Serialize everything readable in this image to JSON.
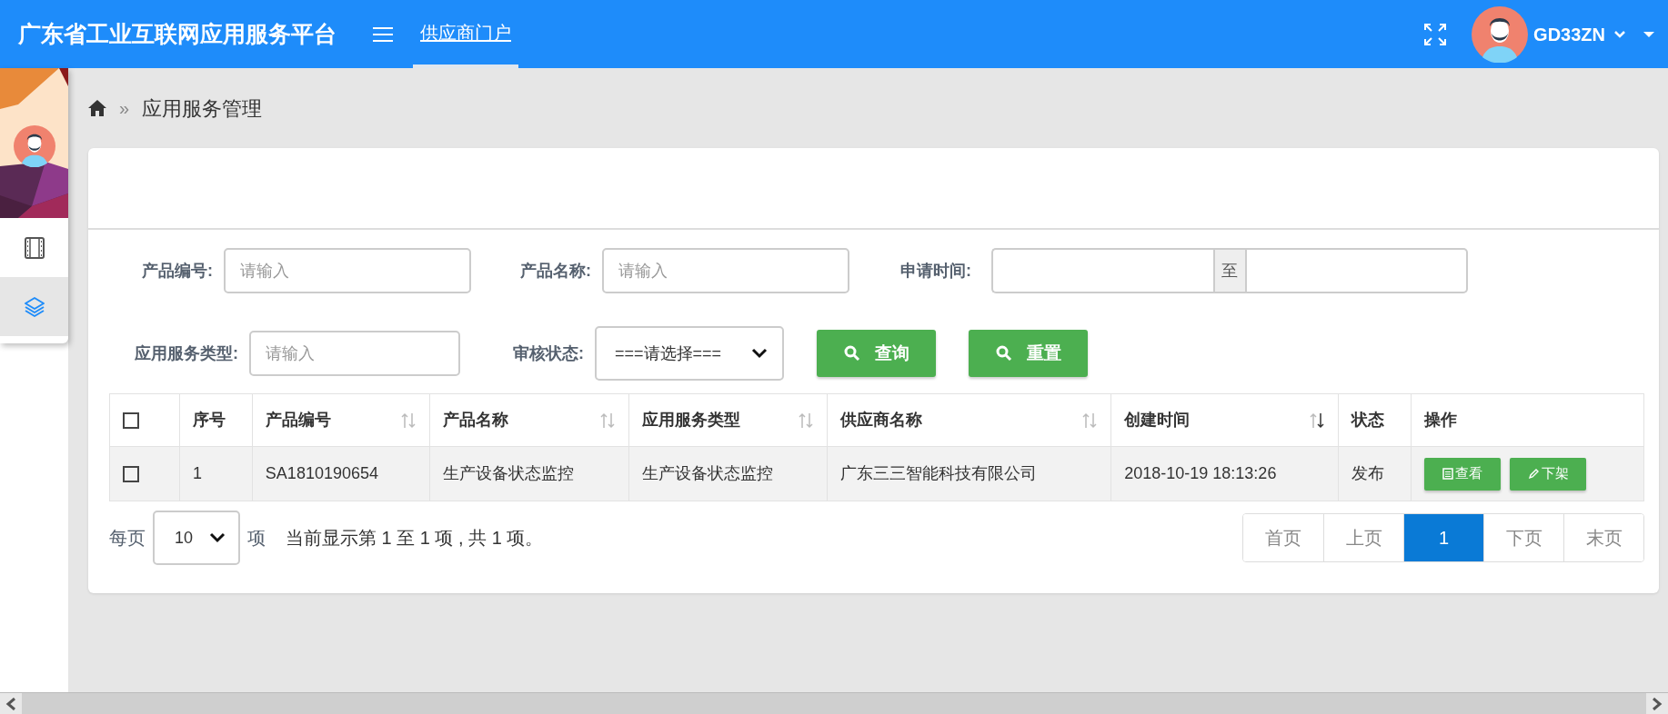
{
  "header": {
    "title": "广东省工业互联网应用服务平台",
    "nav_items": [
      {
        "label": "供应商门户",
        "selected": true
      }
    ],
    "user_name": "GD33ZN"
  },
  "sidebar": {
    "items": [
      {
        "kind": "film",
        "selected": false
      },
      {
        "kind": "layers",
        "selected": true
      }
    ]
  },
  "breadcrumb": {
    "separator": "»",
    "items": [
      "应用服务管理"
    ]
  },
  "filters": [
    {
      "kind": "text",
      "label": "产品编号:",
      "placeholder": "请输入"
    },
    {
      "kind": "text",
      "label": "产品名称:",
      "placeholder": "请输入"
    },
    {
      "kind": "daterange",
      "label": "申请时间:",
      "separator": "至"
    },
    {
      "kind": "text",
      "label": "应用服务类型:",
      "placeholder": "请输入"
    },
    {
      "kind": "select",
      "label": "审核状态:",
      "value": "===请选择==="
    }
  ],
  "buttons": [
    "查询",
    "重置"
  ],
  "table": {
    "select_all_checked": false,
    "columns": [
      {
        "label": "序号",
        "sortable": false,
        "sorted": false
      },
      {
        "label": "产品编号",
        "sortable": true,
        "sorted": false
      },
      {
        "label": "产品名称",
        "sortable": true,
        "sorted": false
      },
      {
        "label": "应用服务类型",
        "sortable": true,
        "sorted": false
      },
      {
        "label": "供应商名称",
        "sortable": true,
        "sorted": false
      },
      {
        "label": "创建时间",
        "sortable": true,
        "sorted": true
      },
      {
        "label": "状态",
        "sortable": false,
        "sorted": false
      },
      {
        "label": "操作",
        "sortable": false,
        "sorted": false
      }
    ],
    "rows": [
      {
        "checked": false,
        "cells": [
          "1",
          "SA1810190654",
          "生产设备状态监控",
          "生产设备状态监控",
          "广东三三智能科技有限公司",
          "2018-10-19 18:13:26",
          "发布"
        ],
        "actions": [
          {
            "kind": "view",
            "label": "查看"
          },
          {
            "kind": "edit",
            "label": "下架"
          }
        ]
      }
    ]
  },
  "pagination": {
    "per_page_label": "每页",
    "per_page": "10",
    "unit": "项",
    "summary": "当前显示第 1 至 1 项 , 共 1 项。",
    "pages": [
      {
        "label": "首页",
        "selected": false
      },
      {
        "label": "上页",
        "selected": false
      },
      {
        "label": "1",
        "selected": true
      },
      {
        "label": "下页",
        "selected": false
      },
      {
        "label": "末页",
        "selected": false
      }
    ]
  }
}
